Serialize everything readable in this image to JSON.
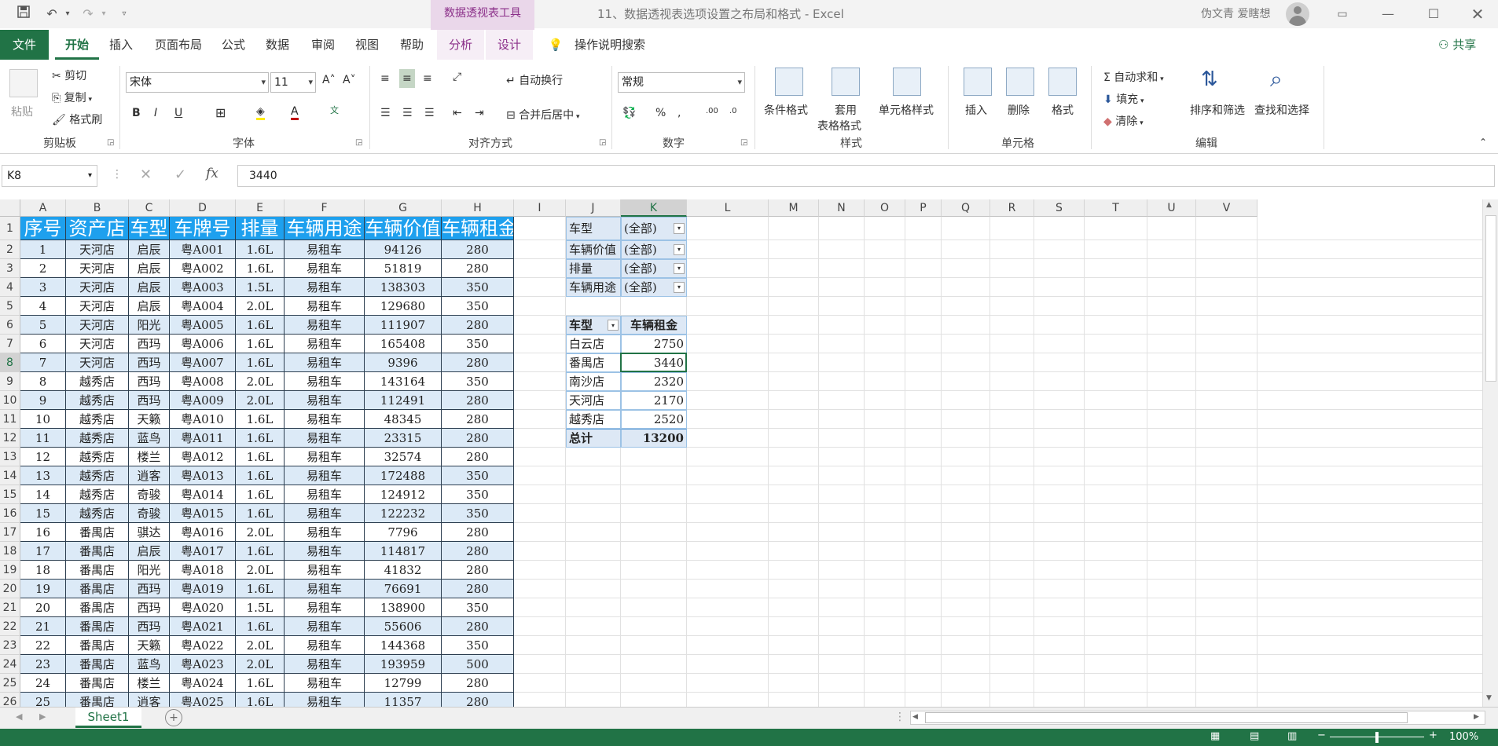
{
  "titlebar": {
    "context_tools": "数据透视表工具",
    "doc_title": "11、数据透视表选项设置之布局和格式  -  Excel",
    "user": "伪文青 爱瞎想"
  },
  "tabs": [
    {
      "label": "文件"
    },
    {
      "label": "开始"
    },
    {
      "label": "插入"
    },
    {
      "label": "页面布局"
    },
    {
      "label": "公式"
    },
    {
      "label": "数据"
    },
    {
      "label": "审阅"
    },
    {
      "label": "视图"
    },
    {
      "label": "帮助"
    },
    {
      "label": "分析"
    },
    {
      "label": "设计"
    },
    {
      "label": "操作说明搜索"
    }
  ],
  "share": "共享",
  "ribbon": {
    "clipboard": {
      "paste": "粘贴",
      "cut": "剪切",
      "copy": "复制",
      "format_painter": "格式刷",
      "label": "剪贴板"
    },
    "font": {
      "name": "宋体",
      "size": "11",
      "label": "字体",
      "bold": "B",
      "italic": "I",
      "underline": "U"
    },
    "align": {
      "wrap": "自动换行",
      "merge": "合并后居中",
      "label": "对齐方式"
    },
    "number": {
      "format": "常规",
      "label": "数字"
    },
    "styles": {
      "conditional": "条件格式",
      "table_line1": "套用",
      "table_line2": "表格格式",
      "cell_styles": "单元格样式",
      "label": "样式"
    },
    "cells": {
      "insert": "插入",
      "delete": "删除",
      "format": "格式",
      "label": "单元格"
    },
    "editing": {
      "autosum": "自动求和",
      "fill": "填充",
      "clear": "清除",
      "sort": "排序和筛选",
      "find": "查找和选择",
      "label": "编辑"
    }
  },
  "formula": {
    "namebox": "K8",
    "fx": "fx",
    "value": "3440"
  },
  "columns": [
    "A",
    "B",
    "C",
    "D",
    "E",
    "F",
    "G",
    "H",
    "I",
    "J",
    "K",
    "L",
    "M",
    "N",
    "O",
    "P",
    "Q",
    "R",
    "S",
    "T",
    "U",
    "V"
  ],
  "table": {
    "headers": [
      "序号",
      "资产店",
      "车型",
      "车牌号",
      "排量",
      "车辆用途",
      "车辆价值",
      "车辆租金"
    ],
    "rows": [
      [
        "1",
        "天河店",
        "启辰",
        "粤A001",
        "1.6L",
        "易租车",
        "94126",
        "280"
      ],
      [
        "2",
        "天河店",
        "启辰",
        "粤A002",
        "1.6L",
        "易租车",
        "51819",
        "280"
      ],
      [
        "3",
        "天河店",
        "启辰",
        "粤A003",
        "1.5L",
        "易租车",
        "138303",
        "350"
      ],
      [
        "4",
        "天河店",
        "启辰",
        "粤A004",
        "2.0L",
        "易租车",
        "129680",
        "350"
      ],
      [
        "5",
        "天河店",
        "阳光",
        "粤A005",
        "1.6L",
        "易租车",
        "111907",
        "280"
      ],
      [
        "6",
        "天河店",
        "西玛",
        "粤A006",
        "1.6L",
        "易租车",
        "165408",
        "350"
      ],
      [
        "7",
        "天河店",
        "西玛",
        "粤A007",
        "1.6L",
        "易租车",
        "9396",
        "280"
      ],
      [
        "8",
        "越秀店",
        "西玛",
        "粤A008",
        "2.0L",
        "易租车",
        "143164",
        "350"
      ],
      [
        "9",
        "越秀店",
        "西玛",
        "粤A009",
        "2.0L",
        "易租车",
        "112491",
        "280"
      ],
      [
        "10",
        "越秀店",
        "天籁",
        "粤A010",
        "1.6L",
        "易租车",
        "48345",
        "280"
      ],
      [
        "11",
        "越秀店",
        "蓝鸟",
        "粤A011",
        "1.6L",
        "易租车",
        "23315",
        "280"
      ],
      [
        "12",
        "越秀店",
        "楼兰",
        "粤A012",
        "1.6L",
        "易租车",
        "32574",
        "280"
      ],
      [
        "13",
        "越秀店",
        "逍客",
        "粤A013",
        "1.6L",
        "易租车",
        "172488",
        "350"
      ],
      [
        "14",
        "越秀店",
        "奇骏",
        "粤A014",
        "1.6L",
        "易租车",
        "124912",
        "350"
      ],
      [
        "15",
        "越秀店",
        "奇骏",
        "粤A015",
        "1.6L",
        "易租车",
        "122232",
        "350"
      ],
      [
        "16",
        "番禺店",
        "骐达",
        "粤A016",
        "2.0L",
        "易租车",
        "7796",
        "280"
      ],
      [
        "17",
        "番禺店",
        "启辰",
        "粤A017",
        "1.6L",
        "易租车",
        "114817",
        "280"
      ],
      [
        "18",
        "番禺店",
        "阳光",
        "粤A018",
        "2.0L",
        "易租车",
        "41832",
        "280"
      ],
      [
        "19",
        "番禺店",
        "西玛",
        "粤A019",
        "1.6L",
        "易租车",
        "76691",
        "280"
      ],
      [
        "20",
        "番禺店",
        "西玛",
        "粤A020",
        "1.5L",
        "易租车",
        "138900",
        "350"
      ],
      [
        "21",
        "番禺店",
        "西玛",
        "粤A021",
        "1.6L",
        "易租车",
        "55606",
        "280"
      ],
      [
        "22",
        "番禺店",
        "天籁",
        "粤A022",
        "2.0L",
        "易租车",
        "144368",
        "350"
      ],
      [
        "23",
        "番禺店",
        "蓝鸟",
        "粤A023",
        "2.0L",
        "易租车",
        "193959",
        "500"
      ],
      [
        "24",
        "番禺店",
        "楼兰",
        "粤A024",
        "1.6L",
        "易租车",
        "12799",
        "280"
      ],
      [
        "25",
        "番禺店",
        "逍客",
        "粤A025",
        "1.6L",
        "易租车",
        "11357",
        "280"
      ]
    ]
  },
  "pivot": {
    "filters": [
      {
        "field": "车型",
        "value": "(全部)"
      },
      {
        "field": "车辆价值",
        "value": "(全部)"
      },
      {
        "field": "排量",
        "value": "(全部)"
      },
      {
        "field": "车辆用途",
        "value": "(全部)"
      }
    ],
    "row_header": "车型",
    "value_header": "车辆租金",
    "rows": [
      {
        "label": "白云店",
        "value": "2750"
      },
      {
        "label": "番禺店",
        "value": "3440"
      },
      {
        "label": "南沙店",
        "value": "2320"
      },
      {
        "label": "天河店",
        "value": "2170"
      },
      {
        "label": "越秀店",
        "value": "2520"
      }
    ],
    "total_label": "总计",
    "total_value": "13200"
  },
  "sheet": {
    "tab": "Sheet1"
  },
  "status": {
    "zoom": "100%"
  }
}
